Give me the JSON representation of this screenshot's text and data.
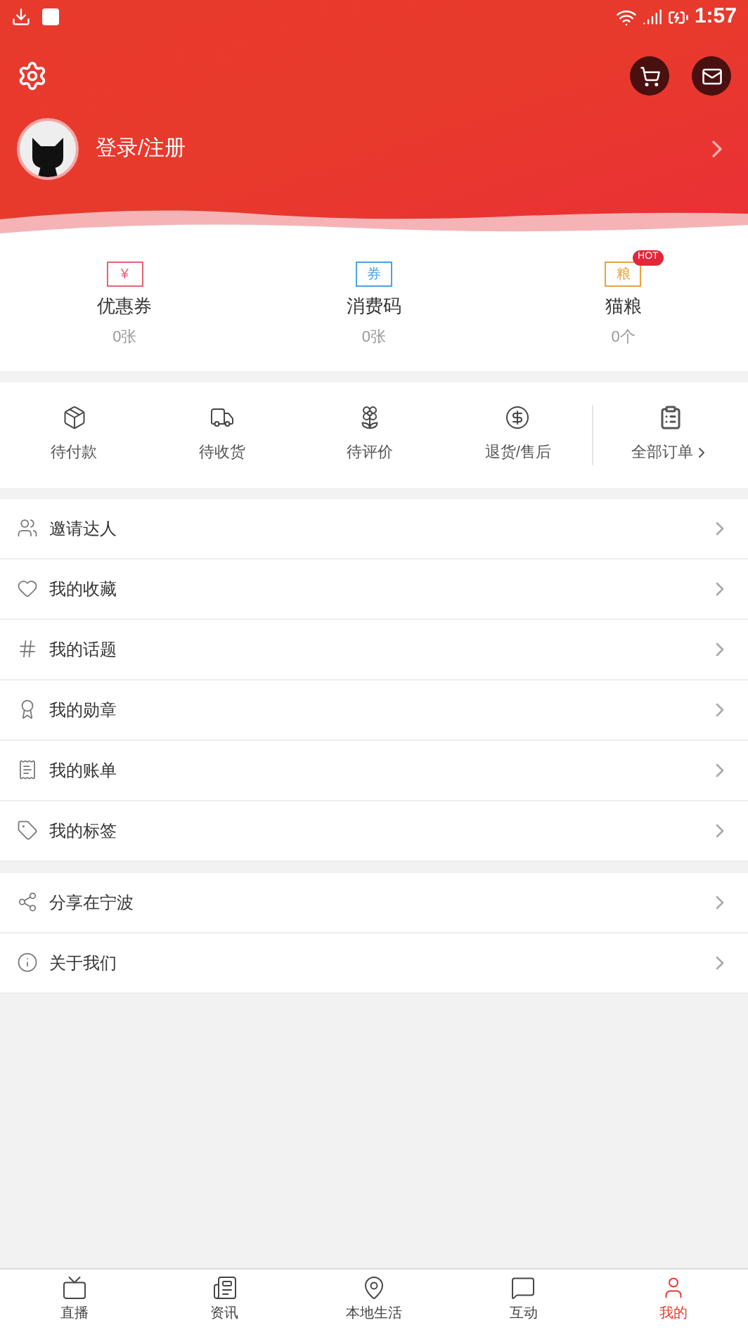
{
  "status_bar": {
    "time": "1:57"
  },
  "profile": {
    "login_label": "登录/注册"
  },
  "assets": [
    {
      "kind": "coupon",
      "label": "优惠券",
      "count": "0张",
      "icon_text": "¥"
    },
    {
      "kind": "code",
      "label": "消费码",
      "count": "0张",
      "icon_text": "券"
    },
    {
      "kind": "food",
      "label": "猫粮",
      "count": "0个",
      "icon_text": "粮",
      "badge": "HOT"
    }
  ],
  "orders": [
    {
      "kind": "pay",
      "label": "待付款"
    },
    {
      "kind": "ship",
      "label": "待收货"
    },
    {
      "kind": "review",
      "label": "待评价"
    },
    {
      "kind": "refund",
      "label": "退货/售后"
    }
  ],
  "all_orders": {
    "label": "全部订单"
  },
  "menu_groups": [
    [
      {
        "kind": "invite",
        "label": "邀请达人"
      },
      {
        "kind": "favorite",
        "label": "我的收藏"
      },
      {
        "kind": "topic",
        "label": "我的话题"
      },
      {
        "kind": "medal",
        "label": "我的勋章"
      },
      {
        "kind": "bill",
        "label": "我的账单"
      },
      {
        "kind": "tag",
        "label": "我的标签"
      }
    ],
    [
      {
        "kind": "share",
        "label": "分享在宁波"
      },
      {
        "kind": "about",
        "label": "关于我们"
      }
    ]
  ],
  "bottom_nav": [
    {
      "kind": "live",
      "label": "直播",
      "selected": false
    },
    {
      "kind": "news",
      "label": "资讯",
      "selected": false
    },
    {
      "kind": "local",
      "label": "本地生活",
      "selected": false
    },
    {
      "kind": "interact",
      "label": "互动",
      "selected": false
    },
    {
      "kind": "mine",
      "label": "我的",
      "selected": true
    }
  ]
}
